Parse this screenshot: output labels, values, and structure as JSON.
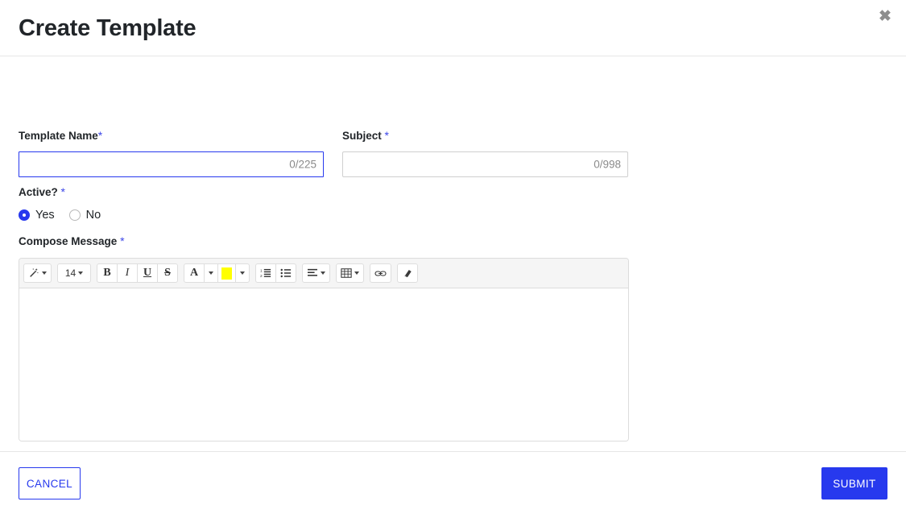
{
  "modal": {
    "title": "Create Template",
    "close_icon": "close-icon"
  },
  "fields": {
    "template_name": {
      "label": "Template Name",
      "required_marker": "*",
      "value": "",
      "placeholder": "",
      "counter": "0/225",
      "max_length": 225,
      "focused": true
    },
    "subject": {
      "label": "Subject",
      "required_marker": "*",
      "value": "",
      "placeholder": "",
      "counter": "0/998",
      "max_length": 998,
      "focused": false
    },
    "active": {
      "label": "Active?",
      "required_marker": "*",
      "options": [
        {
          "label": "Yes",
          "value": "yes",
          "selected": true
        },
        {
          "label": "No",
          "value": "no",
          "selected": false
        }
      ]
    },
    "compose_message": {
      "label": "Compose Message",
      "required_marker": "*",
      "value": ""
    }
  },
  "editor_toolbar": {
    "groups": [
      {
        "buttons": [
          {
            "name": "magic-wand-icon",
            "glyph": "✦",
            "has_caret": true,
            "label": ""
          }
        ]
      },
      {
        "buttons": [
          {
            "name": "font-size-dropdown",
            "glyph": "",
            "has_caret": true,
            "label": "14"
          }
        ]
      },
      {
        "buttons": [
          {
            "name": "bold-icon",
            "glyph": "B",
            "has_caret": false,
            "label": ""
          },
          {
            "name": "italic-icon",
            "glyph": "I",
            "has_caret": false,
            "label": ""
          },
          {
            "name": "underline-icon",
            "glyph": "U",
            "has_caret": false,
            "label": ""
          },
          {
            "name": "strikethrough-icon",
            "glyph": "S",
            "has_caret": false,
            "label": ""
          }
        ]
      },
      {
        "buttons": [
          {
            "name": "font-color-icon",
            "glyph": "A",
            "has_caret": false,
            "label": ""
          },
          {
            "name": "font-color-dropdown",
            "glyph": "",
            "has_caret": true,
            "label": ""
          },
          {
            "name": "highlight-color-swatch",
            "glyph": "",
            "has_caret": false,
            "label": ""
          },
          {
            "name": "highlight-color-dropdown",
            "glyph": "",
            "has_caret": true,
            "label": ""
          }
        ]
      },
      {
        "buttons": [
          {
            "name": "ordered-list-icon",
            "glyph": "",
            "has_caret": false,
            "label": ""
          },
          {
            "name": "unordered-list-icon",
            "glyph": "",
            "has_caret": false,
            "label": ""
          }
        ]
      },
      {
        "buttons": [
          {
            "name": "paragraph-align-icon",
            "glyph": "",
            "has_caret": true,
            "label": ""
          }
        ]
      },
      {
        "buttons": [
          {
            "name": "table-icon",
            "glyph": "",
            "has_caret": true,
            "label": ""
          }
        ]
      },
      {
        "buttons": [
          {
            "name": "link-icon",
            "glyph": "",
            "has_caret": false,
            "label": ""
          }
        ]
      },
      {
        "buttons": [
          {
            "name": "eraser-icon",
            "glyph": "",
            "has_caret": false,
            "label": ""
          }
        ]
      }
    ],
    "highlight_color": "#ffff00",
    "font_size_value": "14"
  },
  "footer": {
    "cancel_label": "CANCEL",
    "submit_label": "SUBMIT"
  },
  "colors": {
    "accent": "#2739ee",
    "required_star": "#3b45e8",
    "highlight": "#ffff00",
    "border": "#dcdcdc",
    "toolbar_bg": "#f5f5f5"
  }
}
